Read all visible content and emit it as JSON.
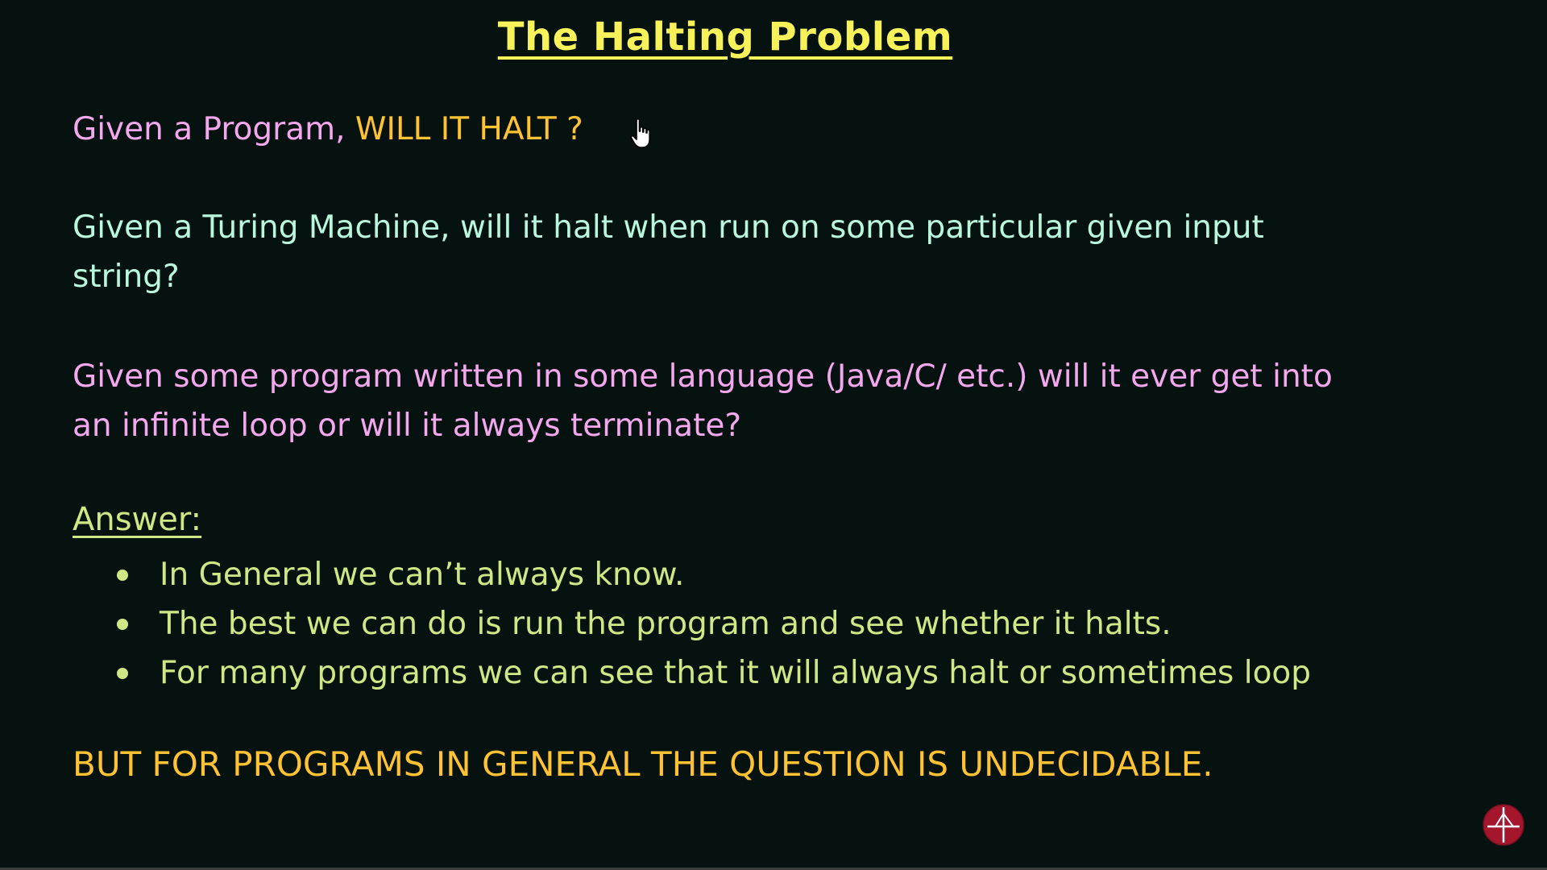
{
  "slide": {
    "title": "The Halting Problem",
    "question": {
      "prefix": "Given a Program, ",
      "emphasis": "WILL IT HALT ?"
    },
    "turing_paragraph": {
      "line1": "Given a Turing Machine, will it halt when run on some particular given input",
      "line2": "string?"
    },
    "program_paragraph": {
      "line1": "Given some program written in some language (Java/C/ etc.) will it ever get into",
      "line2": "an infinite loop or will it always terminate?"
    },
    "answer_heading": "Answer:",
    "answer_points": [
      "In General we can’t always know.",
      "The best we can do is run the program and see whether it halts.",
      "For many programs we can see that it will always halt or sometimes loop"
    ],
    "conclusion": "BUT FOR PROGRAMS IN GENERAL THE QUESTION IS UNDECIDABLE."
  },
  "colors": {
    "background": "#06120f",
    "title": "#f7f25a",
    "pink_text": "#f3a7ec",
    "orange_text": "#ffc233",
    "teal_text": "#b9f7de",
    "green_text": "#cfe785",
    "logo": "#a3162b"
  },
  "icons": {
    "cursor": "hand-pointer-icon",
    "logo": "channel-logo-icon"
  }
}
